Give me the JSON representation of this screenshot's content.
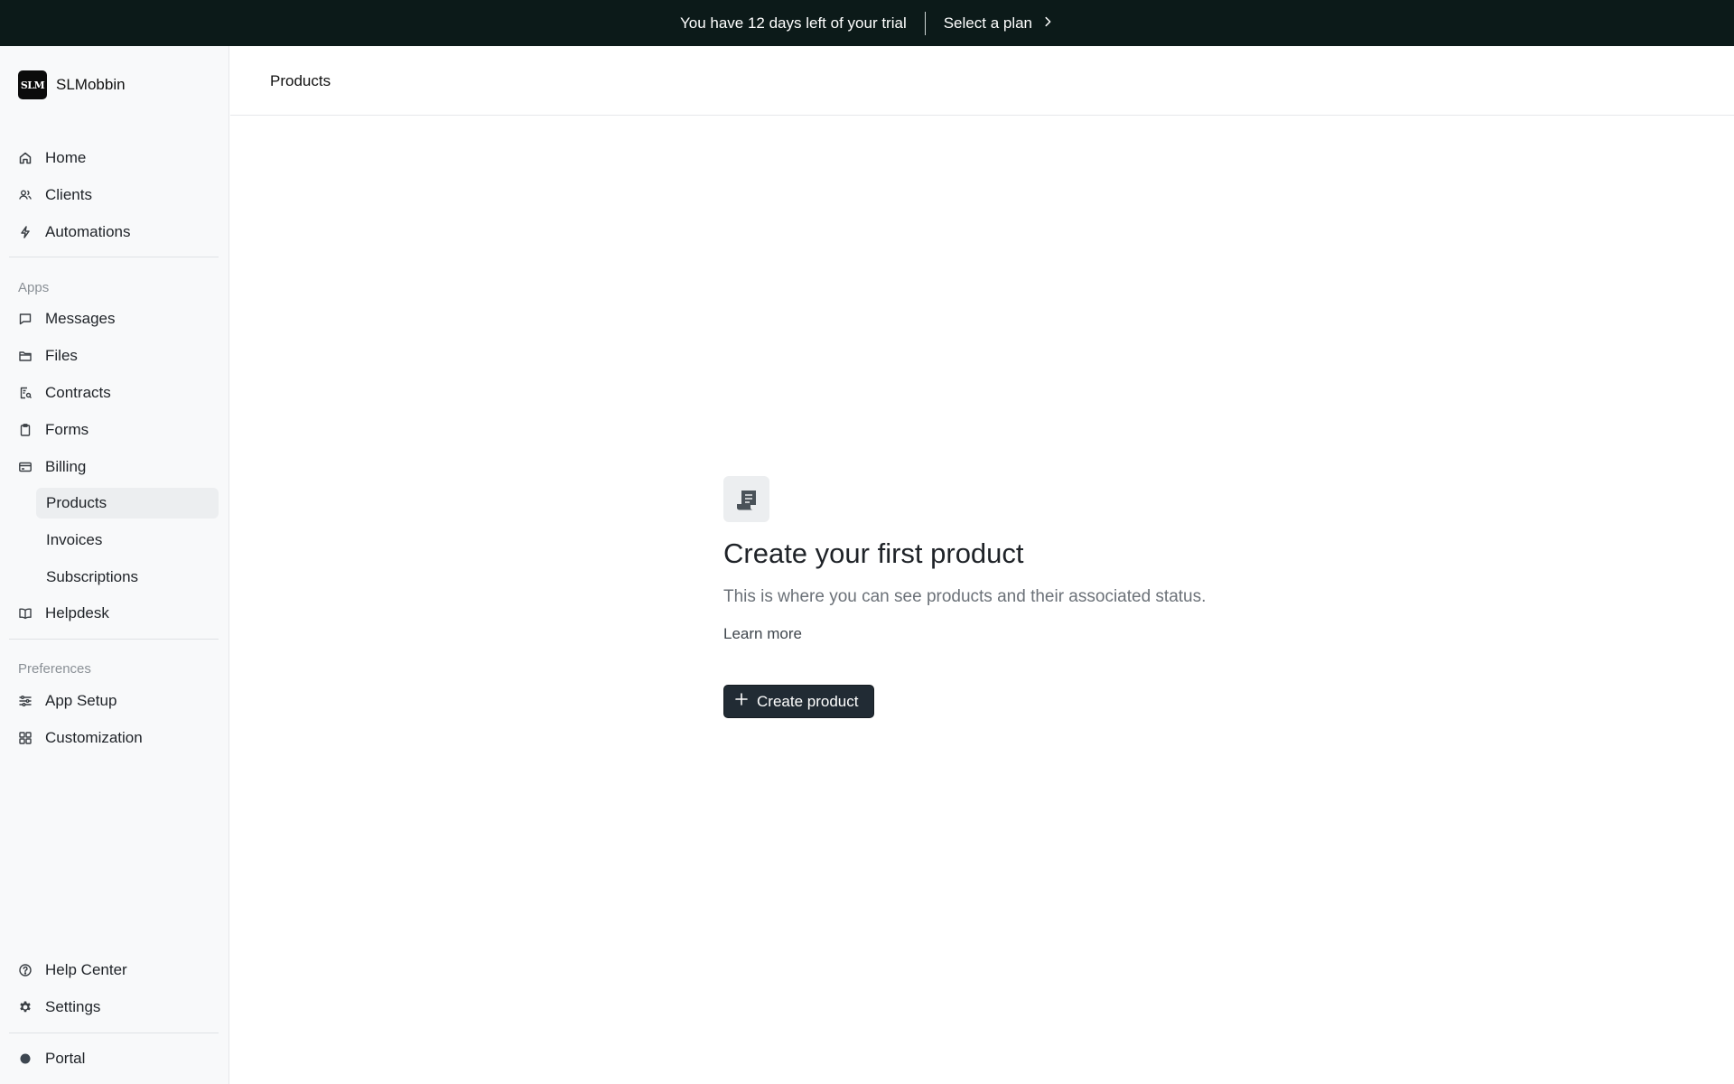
{
  "banner": {
    "trial_text": "You have 12 days left of your trial",
    "plan_label": "Select a plan"
  },
  "brand": {
    "logo_text": "SLM",
    "name": "SLMobbin"
  },
  "sidebar": {
    "main": [
      {
        "label": "Home",
        "icon": "home-icon"
      },
      {
        "label": "Clients",
        "icon": "users-icon"
      },
      {
        "label": "Automations",
        "icon": "bolt-icon"
      }
    ],
    "apps_label": "Apps",
    "apps": [
      {
        "label": "Messages",
        "icon": "message-icon"
      },
      {
        "label": "Files",
        "icon": "folder-icon"
      },
      {
        "label": "Contracts",
        "icon": "contract-icon"
      },
      {
        "label": "Forms",
        "icon": "clipboard-icon"
      },
      {
        "label": "Billing",
        "icon": "credit-card-icon"
      }
    ],
    "billing_sub": [
      {
        "label": "Products",
        "active": true
      },
      {
        "label": "Invoices",
        "active": false
      },
      {
        "label": "Subscriptions",
        "active": false
      }
    ],
    "helpdesk": {
      "label": "Helpdesk",
      "icon": "book-icon"
    },
    "preferences_label": "Preferences",
    "preferences": [
      {
        "label": "App Setup",
        "icon": "sliders-icon"
      },
      {
        "label": "Customization",
        "icon": "grid-icon"
      }
    ],
    "bottom": [
      {
        "label": "Help Center",
        "icon": "help-circle-icon"
      },
      {
        "label": "Settings",
        "icon": "gear-icon"
      }
    ],
    "portal": {
      "label": "Portal",
      "icon": "dot-icon"
    }
  },
  "header": {
    "title": "Products"
  },
  "empty_state": {
    "icon": "receipt-icon",
    "heading": "Create your first product",
    "description": "This is where you can see products and their associated status.",
    "learn_more": "Learn more",
    "create_button": "Create product"
  },
  "colors": {
    "banner_bg": "#0c1a19",
    "button_bg": "#212b34",
    "sidebar_bg": "#f8f9fa",
    "active_bg": "#eceef0"
  }
}
